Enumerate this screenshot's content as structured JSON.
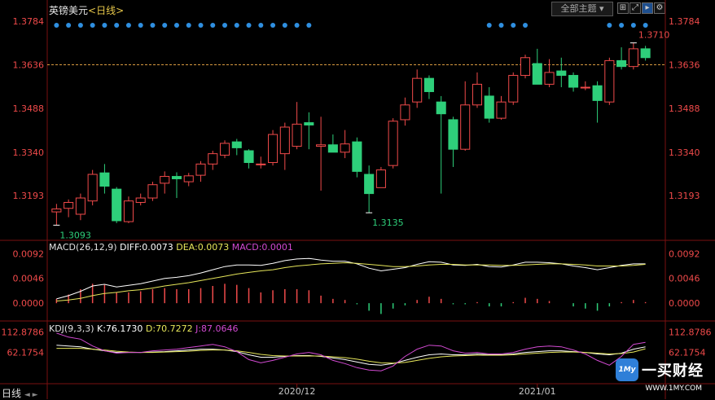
{
  "header": {
    "instrument": "英镑美元",
    "period": "<日线>",
    "theme_button": "全部主题",
    "icons": [
      "grid-icon",
      "expand-icon",
      "next-icon",
      "settings-icon"
    ]
  },
  "macd": {
    "title": "MACD(26,12,9)",
    "diff": "DIFF:0.0073",
    "dea": "DEA:0.0073",
    "macd": "MACD:0.0001"
  },
  "kdj": {
    "title": "KDJ(9,3,3)",
    "k": "K:76.1730",
    "d": "D:70.7272",
    "j": "J:87.0646"
  },
  "bottom_bar": {
    "label": "日线",
    "arrows": "◄ ►"
  },
  "watermark": {
    "name": "一买财经",
    "logo": "1My",
    "url": "WWW.1MY.COM"
  },
  "colors": {
    "up": "#f04a4a",
    "down": "#2ecf7a",
    "diff": "#ffffff",
    "dea": "#e6e65a",
    "k": "#ffffff",
    "d": "#e6e65a",
    "j": "#d24ad2",
    "dot": "#2f8fe0"
  },
  "chart_data": [
    {
      "type": "candlestick",
      "title": "英镑美元 日线",
      "y_ticks": [
        "1.3784",
        "1.3636",
        "1.3488",
        "1.3340",
        "1.3193"
      ],
      "ylim": [
        1.305,
        1.38
      ],
      "x_ticks": [
        "2020/12",
        "2021/01"
      ],
      "reference_line": 1.3636,
      "annotations": [
        {
          "text": "1.3093",
          "value": 1.3093,
          "kind": "low"
        },
        {
          "text": "1.3135",
          "value": 1.3135,
          "kind": "low"
        },
        {
          "text": "1.3710",
          "value": 1.371,
          "kind": "high"
        }
      ],
      "grid": false,
      "candles": [
        {
          "o": 1.3138,
          "h": 1.3165,
          "l": 1.3093,
          "c": 1.3148
        },
        {
          "o": 1.315,
          "h": 1.318,
          "l": 1.312,
          "c": 1.317
        },
        {
          "o": 1.313,
          "h": 1.32,
          "l": 1.311,
          "c": 1.3185
        },
        {
          "o": 1.3175,
          "h": 1.328,
          "l": 1.316,
          "c": 1.3265
        },
        {
          "o": 1.327,
          "h": 1.33,
          "l": 1.32,
          "c": 1.3225
        },
        {
          "o": 1.3215,
          "h": 1.3222,
          "l": 1.31,
          "c": 1.3108
        },
        {
          "o": 1.3105,
          "h": 1.319,
          "l": 1.31,
          "c": 1.3175
        },
        {
          "o": 1.317,
          "h": 1.32,
          "l": 1.316,
          "c": 1.3185
        },
        {
          "o": 1.3185,
          "h": 1.324,
          "l": 1.3175,
          "c": 1.323
        },
        {
          "o": 1.3235,
          "h": 1.3275,
          "l": 1.32,
          "c": 1.3258
        },
        {
          "o": 1.3258,
          "h": 1.3272,
          "l": 1.3185,
          "c": 1.325
        },
        {
          "o": 1.324,
          "h": 1.327,
          "l": 1.3225,
          "c": 1.326
        },
        {
          "o": 1.3262,
          "h": 1.331,
          "l": 1.324,
          "c": 1.33
        },
        {
          "o": 1.33,
          "h": 1.3345,
          "l": 1.328,
          "c": 1.3335
        },
        {
          "o": 1.333,
          "h": 1.338,
          "l": 1.332,
          "c": 1.337
        },
        {
          "o": 1.3375,
          "h": 1.3385,
          "l": 1.333,
          "c": 1.3355
        },
        {
          "o": 1.3345,
          "h": 1.335,
          "l": 1.3285,
          "c": 1.3305
        },
        {
          "o": 1.3298,
          "h": 1.3325,
          "l": 1.3285,
          "c": 1.33
        },
        {
          "o": 1.3305,
          "h": 1.3415,
          "l": 1.3295,
          "c": 1.34
        },
        {
          "o": 1.3335,
          "h": 1.344,
          "l": 1.328,
          "c": 1.3425
        },
        {
          "o": 1.336,
          "h": 1.351,
          "l": 1.335,
          "c": 1.3435
        },
        {
          "o": 1.344,
          "h": 1.3475,
          "l": 1.335,
          "c": 1.3432
        },
        {
          "o": 1.336,
          "h": 1.346,
          "l": 1.321,
          "c": 1.3365
        },
        {
          "o": 1.3365,
          "h": 1.34,
          "l": 1.334,
          "c": 1.334
        },
        {
          "o": 1.334,
          "h": 1.3415,
          "l": 1.332,
          "c": 1.3368
        },
        {
          "o": 1.3375,
          "h": 1.339,
          "l": 1.3255,
          "c": 1.3275
        },
        {
          "o": 1.3265,
          "h": 1.3295,
          "l": 1.3135,
          "c": 1.32
        },
        {
          "o": 1.322,
          "h": 1.329,
          "l": 1.322,
          "c": 1.328
        },
        {
          "o": 1.3295,
          "h": 1.3455,
          "l": 1.3285,
          "c": 1.3445
        },
        {
          "o": 1.345,
          "h": 1.3525,
          "l": 1.343,
          "c": 1.35
        },
        {
          "o": 1.351,
          "h": 1.362,
          "l": 1.349,
          "c": 1.359
        },
        {
          "o": 1.359,
          "h": 1.36,
          "l": 1.352,
          "c": 1.3545
        },
        {
          "o": 1.351,
          "h": 1.353,
          "l": 1.32,
          "c": 1.347
        },
        {
          "o": 1.345,
          "h": 1.346,
          "l": 1.329,
          "c": 1.335
        },
        {
          "o": 1.335,
          "h": 1.358,
          "l": 1.3345,
          "c": 1.35
        },
        {
          "o": 1.35,
          "h": 1.361,
          "l": 1.349,
          "c": 1.357
        },
        {
          "o": 1.353,
          "h": 1.356,
          "l": 1.344,
          "c": 1.3455
        },
        {
          "o": 1.3455,
          "h": 1.353,
          "l": 1.345,
          "c": 1.351
        },
        {
          "o": 1.351,
          "h": 1.361,
          "l": 1.35,
          "c": 1.36
        },
        {
          "o": 1.36,
          "h": 1.367,
          "l": 1.359,
          "c": 1.366
        },
        {
          "o": 1.364,
          "h": 1.369,
          "l": 1.357,
          "c": 1.357
        },
        {
          "o": 1.357,
          "h": 1.3655,
          "l": 1.356,
          "c": 1.361
        },
        {
          "o": 1.3615,
          "h": 1.366,
          "l": 1.356,
          "c": 1.36
        },
        {
          "o": 1.36,
          "h": 1.361,
          "l": 1.3545,
          "c": 1.356
        },
        {
          "o": 1.356,
          "h": 1.358,
          "l": 1.355,
          "c": 1.356
        },
        {
          "o": 1.3565,
          "h": 1.358,
          "l": 1.344,
          "c": 1.3515
        },
        {
          "o": 1.351,
          "h": 1.366,
          "l": 1.35,
          "c": 1.365
        },
        {
          "o": 1.365,
          "h": 1.3695,
          "l": 1.362,
          "c": 1.363
        },
        {
          "o": 1.363,
          "h": 1.371,
          "l": 1.362,
          "c": 1.369
        },
        {
          "o": 1.369,
          "h": 1.37,
          "l": 1.365,
          "c": 1.366
        }
      ]
    },
    {
      "type": "line",
      "title": "MACD(26,12,9)",
      "y_ticks": [
        "0.0092",
        "0.0046",
        "0.0000"
      ],
      "ylim": [
        -0.003,
        0.01
      ],
      "series": [
        {
          "name": "DIFF",
          "values": [
            0.0008,
            0.0014,
            0.0022,
            0.0032,
            0.0035,
            0.003,
            0.0033,
            0.0036,
            0.0041,
            0.0046,
            0.0048,
            0.0051,
            0.0056,
            0.0062,
            0.0068,
            0.0071,
            0.0071,
            0.007,
            0.0074,
            0.0079,
            0.0082,
            0.0083,
            0.008,
            0.0078,
            0.0078,
            0.0073,
            0.0065,
            0.006,
            0.0063,
            0.0066,
            0.0072,
            0.0077,
            0.0076,
            0.0071,
            0.007,
            0.0072,
            0.0068,
            0.0067,
            0.0071,
            0.0076,
            0.0076,
            0.0075,
            0.0073,
            0.0069,
            0.0066,
            0.0062,
            0.0066,
            0.007,
            0.0073,
            0.0073
          ]
        },
        {
          "name": "DEA",
          "values": [
            0.0004,
            0.0006,
            0.0009,
            0.0014,
            0.0018,
            0.002,
            0.0023,
            0.0025,
            0.0028,
            0.0032,
            0.0035,
            0.0038,
            0.0042,
            0.0046,
            0.005,
            0.0054,
            0.0057,
            0.006,
            0.0062,
            0.0066,
            0.0069,
            0.0071,
            0.0073,
            0.0074,
            0.0075,
            0.0074,
            0.0072,
            0.007,
            0.0068,
            0.0068,
            0.0069,
            0.0071,
            0.0072,
            0.0072,
            0.0071,
            0.0071,
            0.0071,
            0.007,
            0.007,
            0.0071,
            0.0072,
            0.0073,
            0.0073,
            0.0072,
            0.0071,
            0.0069,
            0.0069,
            0.0069,
            0.007,
            0.0072
          ]
        }
      ],
      "histogram": [
        0.0008,
        0.0016,
        0.0026,
        0.0036,
        0.0034,
        0.002,
        0.002,
        0.0022,
        0.0026,
        0.0028,
        0.0026,
        0.0026,
        0.0028,
        0.0032,
        0.0036,
        0.0034,
        0.0028,
        0.002,
        0.0024,
        0.0026,
        0.0026,
        0.0024,
        0.0014,
        0.0008,
        0.0006,
        -0.0002,
        -0.0014,
        -0.002,
        -0.001,
        -0.0004,
        0.0006,
        0.0012,
        0.0008,
        -0.0002,
        -0.0002,
        0.0002,
        -0.0006,
        -0.0006,
        0.0002,
        0.001,
        0.0008,
        0.0004,
        0.0,
        -0.0006,
        -0.001,
        -0.0014,
        -0.0006,
        0.0002,
        0.0006,
        0.0002
      ]
    },
    {
      "type": "line",
      "title": "KDJ(9,3,3)",
      "y_ticks": [
        "112.8786",
        "62.1754"
      ],
      "ylim": [
        -10,
        120
      ],
      "series": [
        {
          "name": "K",
          "values": [
            80,
            78,
            76,
            70,
            66,
            62,
            62,
            62,
            63,
            64,
            66,
            68,
            70,
            70,
            68,
            64,
            56,
            50,
            50,
            52,
            54,
            54,
            52,
            48,
            44,
            38,
            32,
            30,
            34,
            42,
            50,
            56,
            58,
            56,
            56,
            58,
            56,
            56,
            58,
            62,
            64,
            66,
            66,
            64,
            62,
            58,
            56,
            60,
            70,
            76
          ]
        },
        {
          "name": "D",
          "values": [
            72,
            72,
            72,
            70,
            68,
            65,
            63,
            62,
            62,
            63,
            64,
            65,
            67,
            68,
            68,
            66,
            62,
            57,
            54,
            53,
            53,
            53,
            53,
            51,
            49,
            45,
            40,
            36,
            35,
            37,
            42,
            47,
            51,
            53,
            54,
            55,
            55,
            55,
            56,
            58,
            60,
            62,
            63,
            63,
            62,
            60,
            58,
            59,
            63,
            71
          ]
        },
        {
          "name": "J",
          "values": [
            110,
            100,
            95,
            78,
            66,
            60,
            62,
            62,
            66,
            68,
            70,
            74,
            78,
            82,
            76,
            64,
            44,
            36,
            42,
            50,
            58,
            62,
            56,
            42,
            34,
            24,
            18,
            16,
            28,
            52,
            70,
            80,
            78,
            66,
            60,
            62,
            58,
            58,
            62,
            70,
            76,
            78,
            76,
            68,
            58,
            42,
            30,
            52,
            82,
            87
          ]
        }
      ]
    }
  ]
}
